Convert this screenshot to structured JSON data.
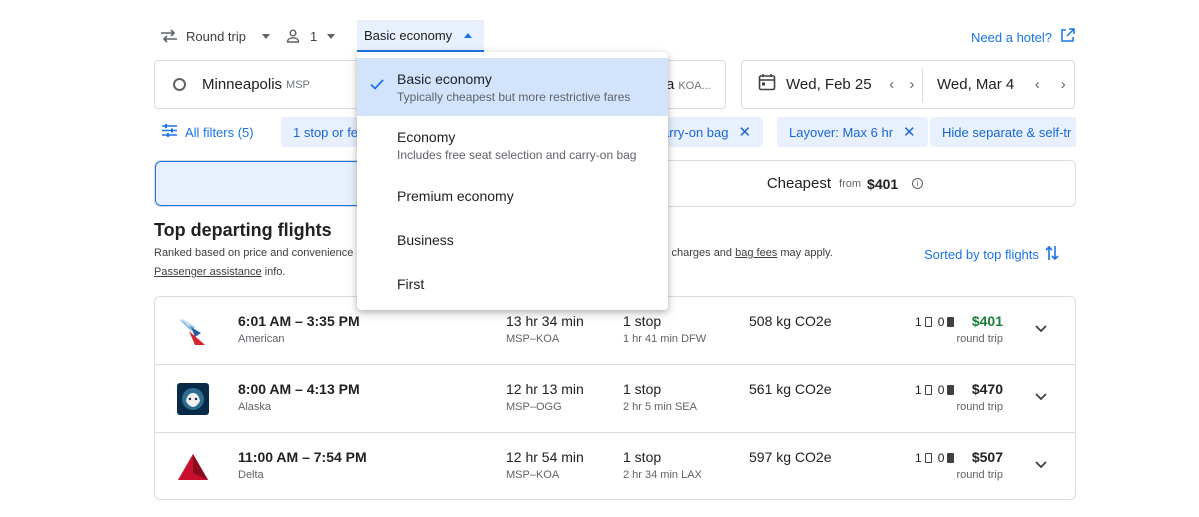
{
  "top_bar": {
    "trip_type": "Round trip",
    "passengers": "1",
    "cabin": "Basic economy",
    "hotel_link": "Need a hotel?"
  },
  "search": {
    "origin_city": "Minneapolis",
    "origin_code": "MSP",
    "destination_fragment": "a",
    "destination_code": "KOA...",
    "depart_date": "Wed, Feb 25",
    "return_date": "Wed, Mar 4"
  },
  "filters": {
    "all_filters": "All filters (5)",
    "chips": [
      "1 stop or fe",
      "arry-on bag",
      "Layover: Max 6 hr",
      "Hide separate & self-tr"
    ]
  },
  "sort_tabs": {
    "cheapest_label": "Cheapest",
    "cheapest_from": "from",
    "cheapest_price": "$401"
  },
  "results": {
    "title": "Top departing flights",
    "ranked_note": "Ranked based on price and convenience",
    "charges_prefix": "l charges and",
    "bag_fees": "bag fees",
    "charges_suffix": "may apply.",
    "passenger_assistance": "Passenger assistance",
    "info_suffix": "info.",
    "sorted_by": "Sorted by top flights"
  },
  "flights": [
    {
      "times": "6:01 AM – 3:35 PM",
      "airline": "American",
      "duration": "13 hr 34 min",
      "route": "MSP–KOA",
      "stops": "1 stop",
      "layover": "1 hr 41 min DFW",
      "co2": "508 kg CO2e",
      "carry_on": "1",
      "checked": "0",
      "price": "$401",
      "trip": "round trip",
      "price_color": "#188038"
    },
    {
      "times": "8:00 AM – 4:13 PM",
      "airline": "Alaska",
      "duration": "12 hr 13 min",
      "route": "MSP–OGG",
      "stops": "1 stop",
      "layover": "2 hr 5 min SEA",
      "co2": "561 kg CO2e",
      "carry_on": "1",
      "checked": "0",
      "price": "$470",
      "trip": "round trip",
      "price_color": "#202124"
    },
    {
      "times": "11:00 AM – 7:54 PM",
      "airline": "Delta",
      "duration": "12 hr 54 min",
      "route": "MSP–KOA",
      "stops": "1 stop",
      "layover": "2 hr 34 min LAX",
      "co2": "597 kg CO2e",
      "carry_on": "1",
      "checked": "0",
      "price": "$507",
      "trip": "round trip",
      "price_color": "#202124"
    }
  ],
  "cabin_menu": {
    "options": [
      {
        "label": "Basic economy",
        "description": "Typically cheapest but more restrictive fares",
        "selected": true
      },
      {
        "label": "Economy",
        "description": "Includes free seat selection and carry-on bag",
        "selected": false
      },
      {
        "label": "Premium economy",
        "description": "",
        "selected": false
      },
      {
        "label": "Business",
        "description": "",
        "selected": false
      },
      {
        "label": "First",
        "description": "",
        "selected": false
      }
    ]
  },
  "colors": {
    "accent": "#1a73e8",
    "chip_bg": "#e8f0fe",
    "selected_option_bg": "#d2e3fc",
    "price_green": "#188038"
  },
  "icons": [
    "swap-icon",
    "person-icon",
    "caret-icon",
    "external-link-icon",
    "circle-icon",
    "calendar-icon",
    "chevron-left-icon",
    "chevron-right-icon",
    "filter-icon",
    "close-icon",
    "info-icon",
    "sort-icon",
    "carry-on-bag-icon",
    "checked-bag-icon",
    "expand-icon",
    "check-icon",
    "american-logo",
    "alaska-logo",
    "delta-logo"
  ]
}
